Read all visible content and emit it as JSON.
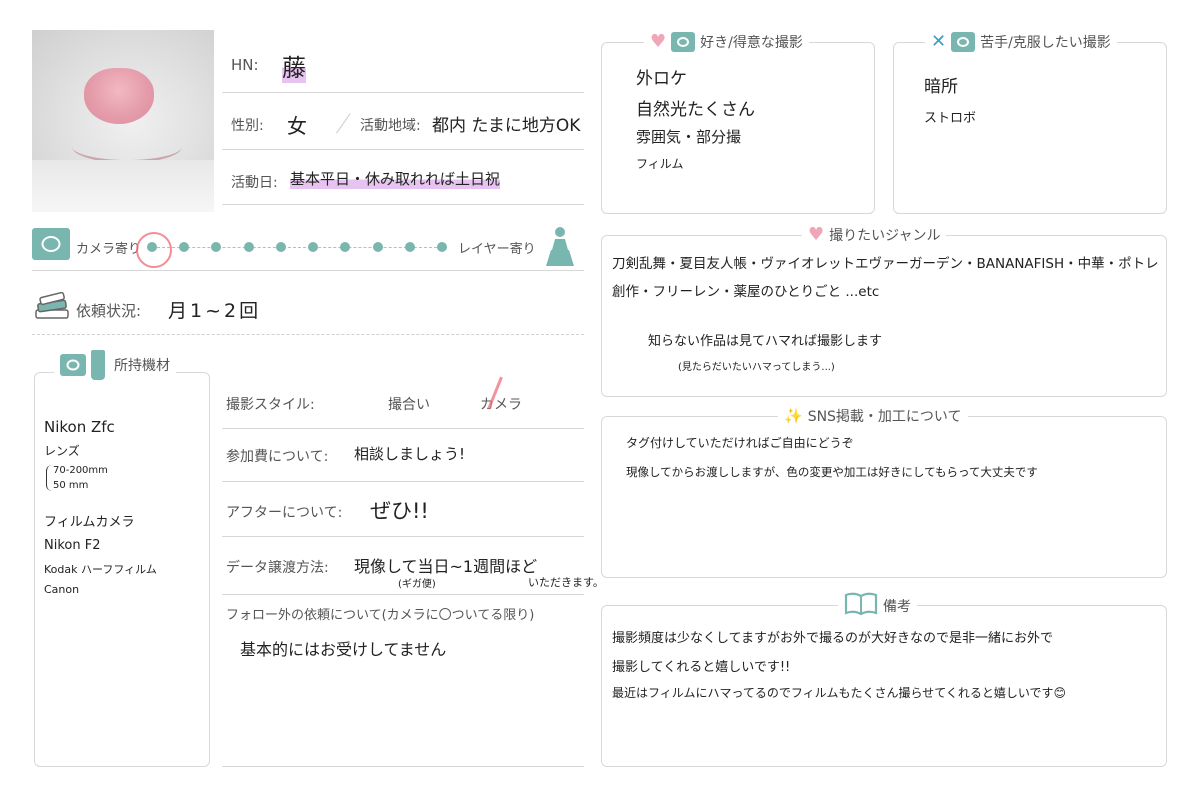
{
  "profile": {
    "hn_label": "HN:",
    "hn_value": "藤",
    "gender_label": "性別:",
    "gender_value": "女",
    "area_label": "活動地域:",
    "area_value": "都内 たまに地方OK",
    "days_label": "活動日:",
    "days_value": "基本平日・休み取れれば土日祝"
  },
  "scale": {
    "left_label": "カメラ寄り",
    "right_label": "レイヤー寄り",
    "dots": 10,
    "selected_index": 0
  },
  "request": {
    "label": "依頼状況:",
    "value": "月1~2回"
  },
  "equipment": {
    "title": "所持機材",
    "lines": [
      "Nikon Zfc",
      "レンズ",
      "70-200mm",
      "50 mm",
      "",
      "フィルムカメラ",
      "Nikon F2",
      "Kodak ハーフフィルム",
      "Canon"
    ]
  },
  "details": {
    "style_label": "撮影スタイル:",
    "style_option1": "撮合い",
    "style_option2": "カメラ",
    "fee_label": "参加費について:",
    "fee_value": "相談しましょう!",
    "after_label": "アフターについて:",
    "after_value": "ぜひ!!",
    "data_label": "データ譲渡方法:",
    "data_value": "現像して当日~1週間ほど",
    "data_note1": "(ギガ便)",
    "data_note2": "いただきます。",
    "follow_label": "フォロー外の依頼について(カメラに〇ついてる限り)",
    "follow_value": "基本的にはお受けしてません"
  },
  "likes": {
    "title": "好き/得意な撮影",
    "lines": [
      "外ロケ",
      "自然光たくさん",
      "雰囲気・部分撮",
      "フィルム"
    ]
  },
  "dislikes": {
    "title": "苦手/克服したい撮影",
    "lines": [
      "暗所",
      "ストロボ"
    ]
  },
  "genres": {
    "title": "撮りたいジャンル",
    "line1": "刀剣乱舞・夏目友人帳・ヴァイオレットエヴァーガーデン・BANANAFISH・中華・ポトレ",
    "line2": "創作・フリーレン・薬屋のひとりごと ...etc",
    "line3": "知らない作品は見てハマれば撮影します",
    "line4": "(見たらだいたいハマってしまう...)"
  },
  "sns": {
    "title": "SNS掲載・加工について",
    "line1": "タグ付けしていただければご自由にどうぞ",
    "line2": "現像してからお渡ししますが、色の変更や加工は好きにしてもらって大丈夫です"
  },
  "notes": {
    "title": "備考",
    "line1": "撮影頻度は少なくしてますがお外で撮るのが大好きなので是非一緒にお外で",
    "line2": "撮影してくれると嬉しいです!!",
    "line3": "最近はフィルムにハマってるのでフィルムもたくさん撮らせてくれると嬉しいです😊"
  },
  "colors": {
    "accent_teal": "#7ab6b0",
    "heart_pink": "#f1a6b8",
    "highlight_purple": "#e6c3f0",
    "circle_red": "#ef6f7c"
  }
}
